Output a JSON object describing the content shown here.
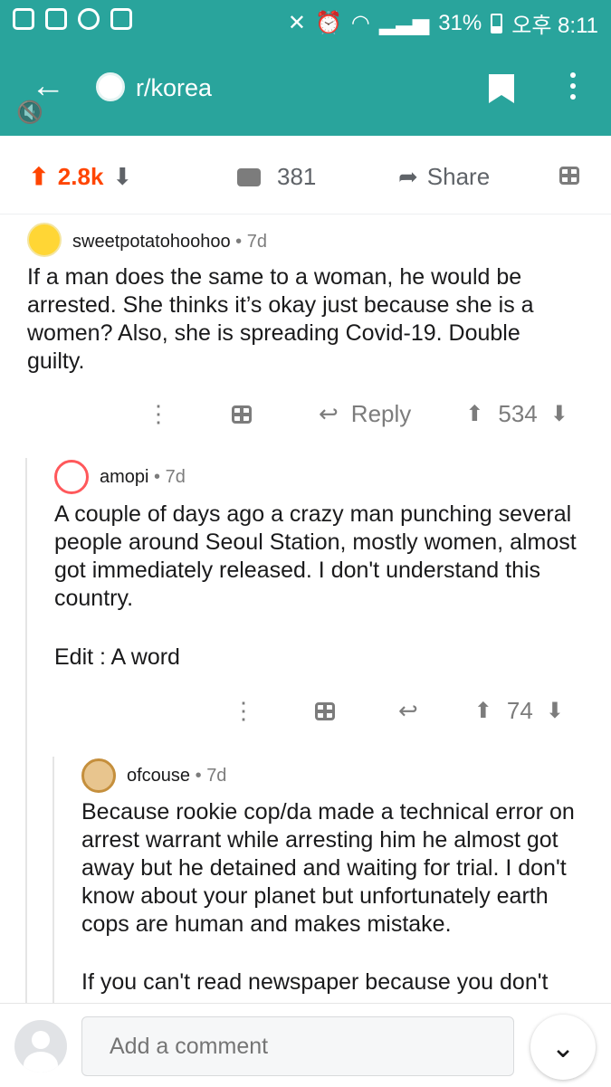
{
  "status_bar": {
    "battery": "31%",
    "time": "오후 8:11"
  },
  "header": {
    "subreddit": "r/korea"
  },
  "post_actions": {
    "score": "2.8k",
    "comments": "381",
    "share": "Share"
  },
  "comments": [
    {
      "author": "sweetpotatohoohoo",
      "age": "7d",
      "text": "If a man does the same to a woman, he would be arrested. She thinks it’s okay just because she is a women? Also, she is spreading Covid-19. Double guilty.",
      "reply_label": "Reply",
      "score": "534"
    },
    {
      "author": "amopi",
      "age": "7d",
      "text": "A couple of days ago a crazy man punching several people around Seoul Station, mostly women, almost got immediately released. I don't understand this country.",
      "edit": "Edit : A word",
      "score": "74"
    },
    {
      "author": "ofcouse",
      "age": "7d",
      "text": "Because  rookie cop/da made a technical error on arrest warrant while arresting him he almost got away but he detained and waiting for trial. I don't know about your planet but unfortunately earth cops are human and makes mistake.",
      "text2": "If you can't read newspaper because you don't"
    }
  ],
  "composer": {
    "placeholder": "Add a comment"
  },
  "colors": {
    "header": "#29a49c",
    "upvote": "#ff4500"
  }
}
